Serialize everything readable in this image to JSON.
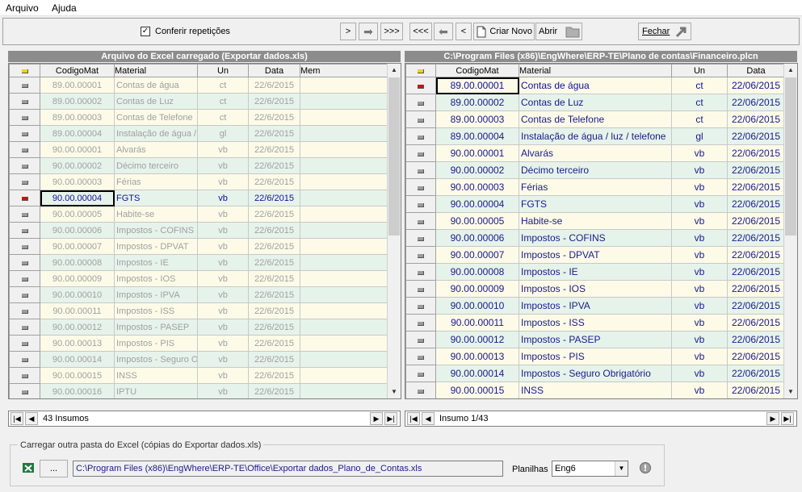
{
  "menu": {
    "arquivo": "Arquivo",
    "ajuda": "Ajuda"
  },
  "toolbar": {
    "checkbox_mark": "✓",
    "conferir_label": "Conferir repetições",
    "next": ">",
    "next_arrow": "➡",
    "last": ">>>",
    "first": "<<<",
    "prev_arrow": "⬅",
    "prev": "<",
    "criar_novo": "Criar Novo",
    "abrir": "Abrir",
    "fechar": "Fechar"
  },
  "left": {
    "title": "Arquivo do Excel carregado (Exportar dados.xls)",
    "headers": [
      "CodigoMat",
      "Material",
      "Un",
      "Data",
      "Mem"
    ],
    "rows": [
      [
        "89.00.00001",
        "Contas de água",
        "ct",
        "22/6/2015",
        ""
      ],
      [
        "89.00.00002",
        "Contas de Luz",
        "ct",
        "22/6/2015",
        ""
      ],
      [
        "89.00.00003",
        "Contas de Telefone",
        "ct",
        "22/6/2015",
        ""
      ],
      [
        "89.00.00004",
        "Instalação de água /",
        "gl",
        "22/6/2015",
        ""
      ],
      [
        "90.00.00001",
        "Alvarás",
        "vb",
        "22/6/2015",
        ""
      ],
      [
        "90.00.00002",
        "Décimo terceiro",
        "vb",
        "22/6/2015",
        ""
      ],
      [
        "90.00.00003",
        "Férias",
        "vb",
        "22/6/2015",
        ""
      ],
      [
        "90.00.00004",
        "FGTS",
        "vb",
        "22/6/2015",
        ""
      ],
      [
        "90.00.00005",
        "Habite-se",
        "vb",
        "22/6/2015",
        ""
      ],
      [
        "90.00.00006",
        "Impostos - COFINS",
        "vb",
        "22/6/2015",
        ""
      ],
      [
        "90.00.00007",
        "Impostos - DPVAT",
        "vb",
        "22/6/2015",
        ""
      ],
      [
        "90.00.00008",
        "Impostos - IE",
        "vb",
        "22/6/2015",
        ""
      ],
      [
        "90.00.00009",
        "Impostos - IOS",
        "vb",
        "22/6/2015",
        ""
      ],
      [
        "90.00.00010",
        "Impostos - IPVA",
        "vb",
        "22/6/2015",
        ""
      ],
      [
        "90.00.00011",
        "Impostos - ISS",
        "vb",
        "22/6/2015",
        ""
      ],
      [
        "90.00.00012",
        "Impostos - PASEP",
        "vb",
        "22/6/2015",
        ""
      ],
      [
        "90.00.00013",
        "Impostos - PIS",
        "vb",
        "22/6/2015",
        ""
      ],
      [
        "90.00.00014",
        "Impostos - Seguro Ol",
        "vb",
        "22/6/2015",
        ""
      ],
      [
        "90.00.00015",
        "INSS",
        "vb",
        "22/6/2015",
        ""
      ],
      [
        "90.00.00016",
        "IPTU",
        "vb",
        "22/6/2015",
        ""
      ]
    ],
    "selected_row": 7,
    "nav_text": "43  Insumos"
  },
  "right": {
    "title": "C:\\Program Files (x86)\\EngWhere\\ERP-TE\\Plano de contas\\Financeiro.plcn",
    "headers": [
      "CodigoMat",
      "Material",
      "Un",
      "Data"
    ],
    "rows": [
      [
        "89.00.00001",
        "Contas de água",
        "ct",
        "22/06/2015"
      ],
      [
        "89.00.00002",
        "Contas de Luz",
        "ct",
        "22/06/2015"
      ],
      [
        "89.00.00003",
        "Contas de Telefone",
        "ct",
        "22/06/2015"
      ],
      [
        "89.00.00004",
        "Instalação de água / luz / telefone",
        "gl",
        "22/06/2015"
      ],
      [
        "90.00.00001",
        "Alvarás",
        "vb",
        "22/06/2015"
      ],
      [
        "90.00.00002",
        "Décimo terceiro",
        "vb",
        "22/06/2015"
      ],
      [
        "90.00.00003",
        "Férias",
        "vb",
        "22/06/2015"
      ],
      [
        "90.00.00004",
        "FGTS",
        "vb",
        "22/06/2015"
      ],
      [
        "90.00.00005",
        "Habite-se",
        "vb",
        "22/06/2015"
      ],
      [
        "90.00.00006",
        "Impostos - COFINS",
        "vb",
        "22/06/2015"
      ],
      [
        "90.00.00007",
        "Impostos - DPVAT",
        "vb",
        "22/06/2015"
      ],
      [
        "90.00.00008",
        "Impostos - IE",
        "vb",
        "22/06/2015"
      ],
      [
        "90.00.00009",
        "Impostos - IOS",
        "vb",
        "22/06/2015"
      ],
      [
        "90.00.00010",
        "Impostos - IPVA",
        "vb",
        "22/06/2015"
      ],
      [
        "90.00.00011",
        "Impostos - ISS",
        "vb",
        "22/06/2015"
      ],
      [
        "90.00.00012",
        "Impostos - PASEP",
        "vb",
        "22/06/2015"
      ],
      [
        "90.00.00013",
        "Impostos - PIS",
        "vb",
        "22/06/2015"
      ],
      [
        "90.00.00014",
        "Impostos - Seguro Obrigatório",
        "vb",
        "22/06/2015"
      ],
      [
        "90.00.00015",
        "INSS",
        "vb",
        "22/06/2015"
      ]
    ],
    "selected_row": 0,
    "nav_text": "Insumo 1/43"
  },
  "bottom": {
    "group_title": "Carregar outra pasta do Excel (cópias do Exportar dados.xls)",
    "browse_label": "...",
    "path": "C:\\Program Files (x86)\\EngWhere\\ERP-TE\\Office\\Exportar dados_Plano_de_Contas.xls",
    "planilhas_label": "Planilhas",
    "planilhas_value": "Eng6"
  },
  "colors": {
    "title_bar": "#8c8c8c",
    "row_cream": "#fdfbe8",
    "row_green": "#e6f3ea",
    "selected_pointer": "#d01010",
    "excel_green": "#1d7a3a"
  }
}
